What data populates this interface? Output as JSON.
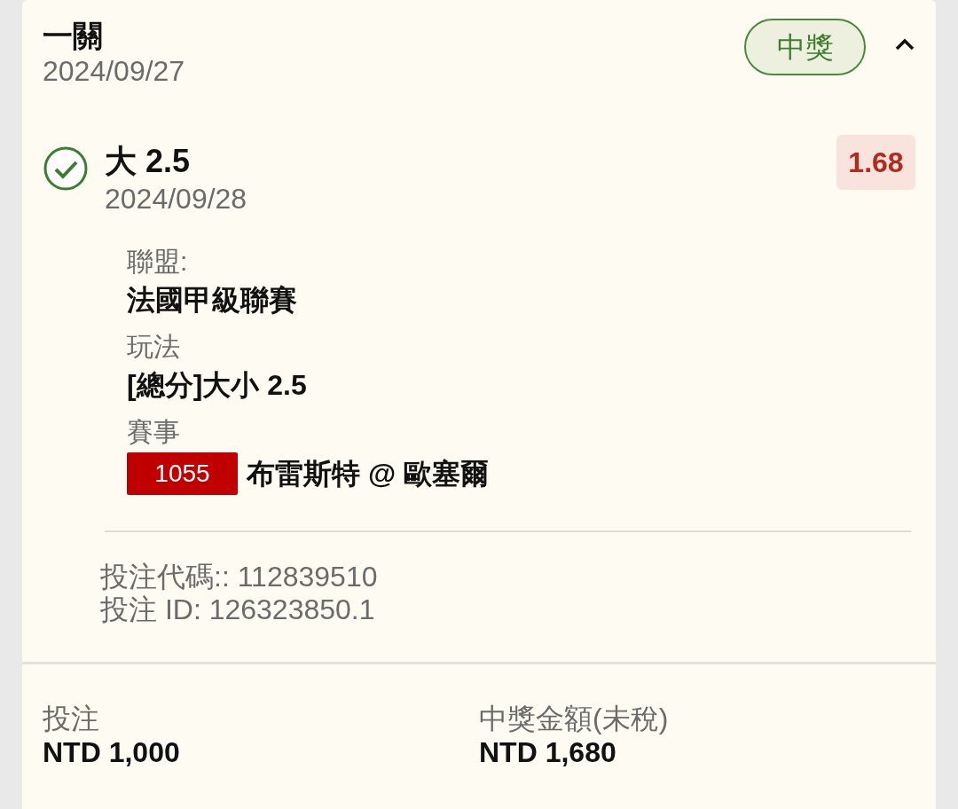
{
  "header": {
    "title": "一關",
    "date": "2024/09/27",
    "status_badge": "中獎",
    "expanded": true
  },
  "selection": {
    "won": true,
    "pick": "大 2.5",
    "date": "2024/09/28",
    "odds": "1.68",
    "details": [
      {
        "kind": "text",
        "label": "聯盟:",
        "value": "法國甲級聯賽"
      },
      {
        "kind": "text",
        "label": "玩法",
        "value": "[總分]大小 2.5"
      },
      {
        "kind": "match",
        "label": "賽事",
        "code": "1055",
        "value": "布雷斯特 @ 歐塞爾"
      }
    ],
    "bet_code": "投注代碼:: 112839510",
    "bet_id": "投注 ID: 126323850.1"
  },
  "summary": [
    {
      "label": "投注",
      "value": "NTD 1,000"
    },
    {
      "label": "中獎金額(未稅)",
      "value": "NTD 1,680"
    }
  ]
}
